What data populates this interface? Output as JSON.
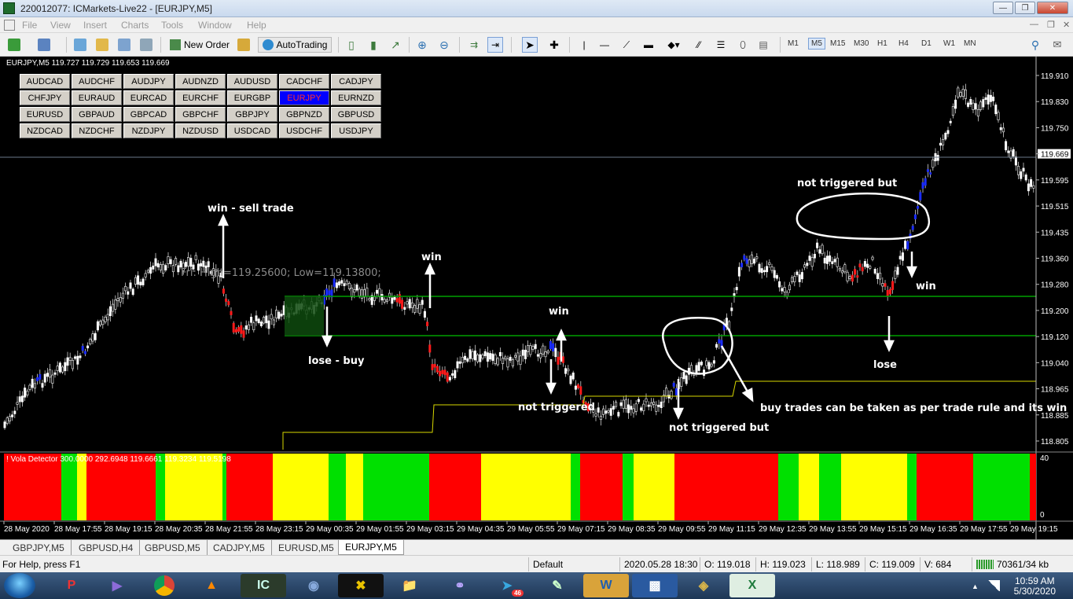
{
  "window": {
    "title": "220012077: ICMarkets-Live22 - [EURJPY,M5]"
  },
  "menu": {
    "items": [
      "File",
      "View",
      "Insert",
      "Charts",
      "Tools",
      "Window",
      "Help"
    ]
  },
  "toolbar": {
    "new_order": "New Order",
    "autotrading": "AutoTrading",
    "timeframes": [
      "M1",
      "M5",
      "M15",
      "M30",
      "H1",
      "H4",
      "D1",
      "W1",
      "MN"
    ],
    "selected_timeframe": "M5"
  },
  "chart": {
    "header": "EURJPY,M5  119.727 119.729 119.653 119.669",
    "price_labels": [
      "119.910",
      "119.830",
      "119.750",
      "119.669",
      "119.595",
      "119.515",
      "119.435",
      "119.360",
      "119.280",
      "119.200",
      "119.120",
      "119.040",
      "118.965",
      "118.885",
      "118.805"
    ],
    "current_price": "119.669",
    "info_text": "Fri:  High=119.25600;  Low=119.13800;",
    "indicator_label": "! Vola Detector 300.0000 292.6948 119.6661 119.3234 119.5198",
    "indicator_scale": [
      "40",
      "0"
    ],
    "time_labels": [
      "28 May 2020",
      "28 May 17:55",
      "28 May 19:15",
      "28 May 20:35",
      "28 May 21:55",
      "28 May 23:15",
      "29 May 00:35",
      "29 May 01:55",
      "29 May 03:15",
      "29 May 04:35",
      "29 May 05:55",
      "29 May 07:15",
      "29 May 08:35",
      "29 May 09:55",
      "29 May 11:15",
      "29 May 12:35",
      "29 May 13:55",
      "29 May 15:15",
      "29 May 16:35",
      "29 May 17:55",
      "29 May 19:15"
    ],
    "annotations": [
      "win - sell trade",
      "lose - buy",
      "win",
      "win",
      "not triggered",
      "not triggered but",
      "buy trades can be taken as per trade rule and its win",
      "not triggered but",
      "win",
      "lose"
    ],
    "colors": {
      "background": "#000000",
      "green_level": "#00a000",
      "indicator_red": "#ff0000",
      "indicator_yellow": "#ffff00",
      "indicator_green": "#00e000",
      "active_symbol": "#0000ff"
    }
  },
  "symbols": [
    "AUDCAD",
    "AUDCHF",
    "AUDJPY",
    "AUDNZD",
    "AUDUSD",
    "CADCHF",
    "CADJPY",
    "CHFJPY",
    "EURAUD",
    "EURCAD",
    "EURCHF",
    "EURGBP",
    "EURJPY",
    "EURNZD",
    "EURUSD",
    "GBPAUD",
    "GBPCAD",
    "GBPCHF",
    "GBPJPY",
    "GBPNZD",
    "GBPUSD",
    "NZDCAD",
    "NZDCHF",
    "NZDJPY",
    "NZDUSD",
    "USDCAD",
    "USDCHF",
    "USDJPY"
  ],
  "active_symbol": "EURJPY",
  "tabs": [
    "GBPJPY,M5",
    "GBPUSD,H4",
    "GBPUSD,M5",
    "CADJPY,M5",
    "EURUSD,M5",
    "EURJPY,M5"
  ],
  "active_tab": "EURJPY,M5",
  "status": {
    "help": "For Help, press F1",
    "profile": "Default",
    "datetime": "2020.05.28 18:30",
    "open": "O: 119.018",
    "high": "H: 119.023",
    "low": "L: 118.989",
    "close": "C: 119.009",
    "volume": "V: 684",
    "traffic": "70361/34 kb"
  },
  "taskbar": {
    "time": "10:59 AM",
    "date": "5/30/2020",
    "badge": "46"
  }
}
